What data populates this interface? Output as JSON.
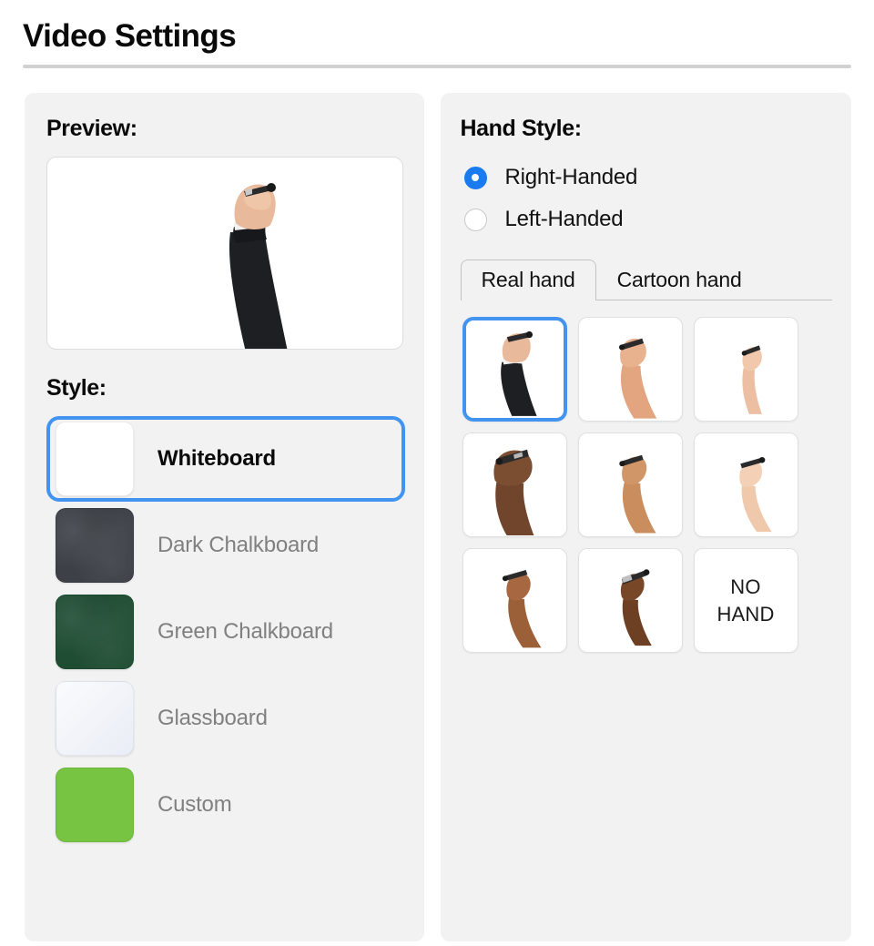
{
  "header": {
    "title": "Video Settings"
  },
  "left_panel": {
    "preview_label": "Preview:",
    "preview_alt": "right-handed-real-hand-with-dark-sleeve-holding-pen",
    "style_label": "Style:",
    "styles": [
      {
        "label": "Whiteboard",
        "color": "#ffffff",
        "selected": true,
        "textured": false
      },
      {
        "label": "Dark Chalkboard",
        "color": "#3d4147",
        "selected": false,
        "textured": true
      },
      {
        "label": "Green Chalkboard",
        "color": "#1f4d33",
        "selected": false,
        "textured": true
      },
      {
        "label": "Glassboard",
        "color": "#eef1f7",
        "selected": false,
        "textured": false
      },
      {
        "label": "Custom",
        "color": "#76c442",
        "selected": false,
        "textured": false
      }
    ]
  },
  "right_panel": {
    "hand_style_label": "Hand Style:",
    "handedness": [
      {
        "label": "Right-Handed",
        "selected": true
      },
      {
        "label": "Left-Handed",
        "selected": false
      }
    ],
    "tabs": [
      {
        "label": "Real hand",
        "active": true
      },
      {
        "label": "Cartoon hand",
        "active": false
      }
    ],
    "hands": [
      {
        "name": "hand-dark-sleeve",
        "skin": "#e8b99a",
        "sleeve": "#1d1f23",
        "selected": true,
        "no_hand": false,
        "label": ""
      },
      {
        "name": "hand-light-forearm",
        "skin": "#e2a57f",
        "sleeve": "",
        "selected": false,
        "no_hand": false,
        "label": ""
      },
      {
        "name": "hand-slim-light",
        "skin": "#edbfa2",
        "sleeve": "",
        "selected": false,
        "no_hand": false,
        "label": ""
      },
      {
        "name": "hand-dark-skin-close",
        "skin": "#70452c",
        "sleeve": "",
        "selected": false,
        "no_hand": false,
        "label": ""
      },
      {
        "name": "hand-medium-tan",
        "skin": "#c98d5e",
        "sleeve": "",
        "selected": false,
        "no_hand": false,
        "label": ""
      },
      {
        "name": "hand-pale-slim",
        "skin": "#f0c9ad",
        "sleeve": "",
        "selected": false,
        "no_hand": false,
        "label": ""
      },
      {
        "name": "hand-brown-slim",
        "skin": "#9c6039",
        "sleeve": "",
        "selected": false,
        "no_hand": false,
        "label": ""
      },
      {
        "name": "hand-dark-brown-watch",
        "skin": "#6e4023",
        "sleeve": "",
        "selected": false,
        "no_hand": false,
        "label": ""
      },
      {
        "name": "no-hand-option",
        "skin": "",
        "sleeve": "",
        "selected": false,
        "no_hand": true,
        "label": "NO\nHAND"
      }
    ]
  },
  "colors": {
    "accent_blue": "#4294f0",
    "radio_blue": "#1a7af0",
    "panel_bg": "#f2f2f2",
    "muted_text": "#808080"
  }
}
